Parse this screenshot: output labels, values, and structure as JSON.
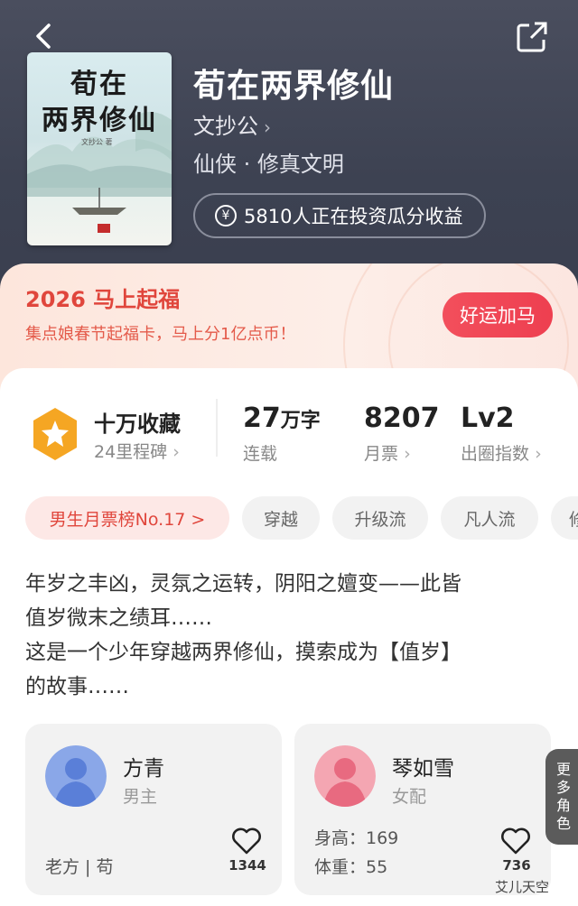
{
  "book": {
    "cover_title_line1": "荀在",
    "cover_title_line2": "两界修仙",
    "cover_author": "文抄公 著",
    "title": "荀在两界修仙",
    "author": "文抄公",
    "genre": "仙侠 · 修真文明",
    "invest_text": "5810人正在投资瓜分收益"
  },
  "promo": {
    "title": "2026 马上起福",
    "subtitle": "集点娘春节起福卡，马上分1亿点币！",
    "button": "好运加马"
  },
  "stats": {
    "collect_label": "十万收藏",
    "milestone": "24里程碑",
    "words_value": "27",
    "words_unit": "万字",
    "words_label": "连载",
    "monthly_value": "8207",
    "monthly_label": "月票",
    "level_value": "Lv2",
    "level_label": "出圈指数"
  },
  "tags": [
    "男生月票榜No.17 >",
    "穿越",
    "升级流",
    "凡人流",
    "修"
  ],
  "description": [
    "年岁之丰凶，灵氛之运转，阴阳之嬗变——此皆",
    "值岁微末之绩耳……",
    "这是一个少年穿越两界修仙，摸索成为【值岁】",
    "的故事……"
  ],
  "roles": [
    {
      "name": "方青",
      "type": "男主",
      "extra1": "老方 | 苟",
      "extra2": "",
      "likes": "1344"
    },
    {
      "name": "琴如雪",
      "type": "女配",
      "extra1": "身高：169",
      "extra2": "体重：55",
      "likes": "736"
    }
  ],
  "more_roles": "更多角色",
  "watermark": "艾儿天空"
}
